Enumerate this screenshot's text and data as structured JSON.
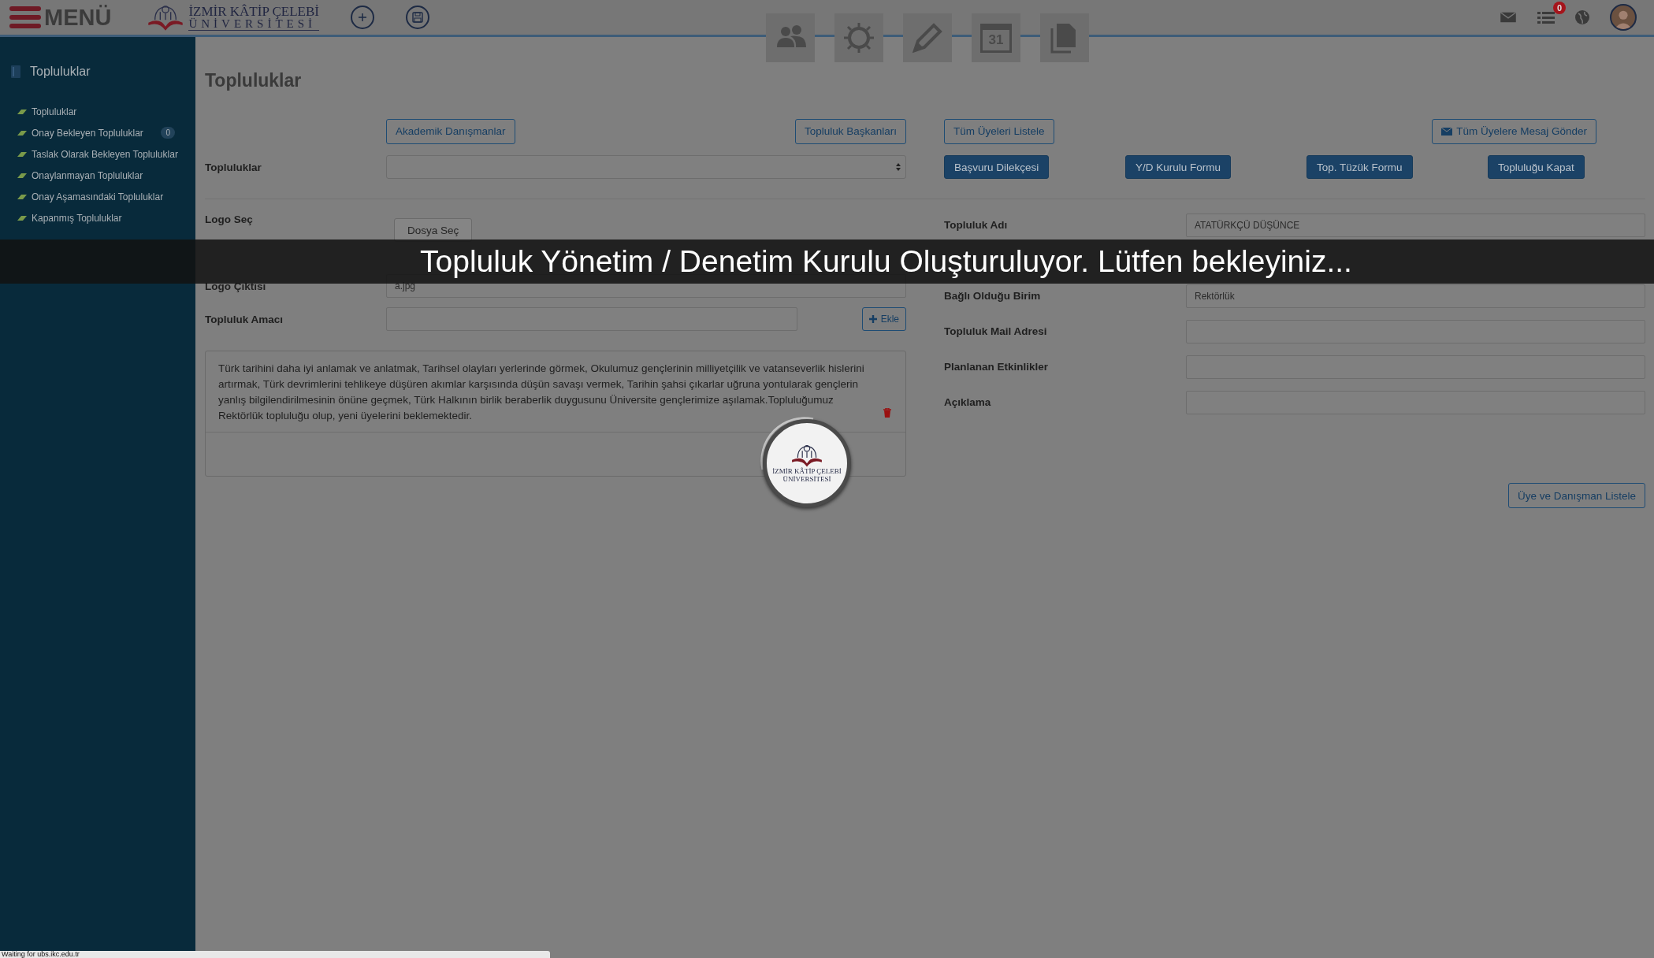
{
  "top_bar": {
    "menu_label": "MENÜ",
    "logo_lines": [
      "İZMİR KÂTİP ÇELEBİ",
      "ÜNİVERSİTESİ"
    ],
    "tiles": [
      {
        "kind": "people"
      },
      {
        "kind": "sun"
      },
      {
        "kind": "pencil"
      },
      {
        "kind": "calendar",
        "text": "31"
      },
      {
        "kind": "documents"
      }
    ],
    "list_badge": "0"
  },
  "sidebar": {
    "title": "Topluluklar",
    "items": [
      {
        "label": "Topluluklar"
      },
      {
        "label": "Onay Bekleyen Topluluklar",
        "badge": "0"
      },
      {
        "label": "Taslak Olarak Bekleyen Topluluklar"
      },
      {
        "label": "Onaylanmayan Topluluklar"
      },
      {
        "label": "Onay Aşamasındaki Topluluklar"
      },
      {
        "label": "Kapanmış Topluluklar"
      }
    ]
  },
  "page_title": "Topluluklar",
  "left_buttons": [
    "Akademik Danışmanlar",
    "Topluluk Başkanları"
  ],
  "select_label": "Topluluklar",
  "right_buttons": [
    {
      "label": "Tüm Üyeleri Listele",
      "kind": "plain"
    },
    {
      "label": "Tüm Üyelere Mesaj Gönder",
      "kind": "mail"
    }
  ],
  "action_buttons": [
    "Başvuru Dilekçesi",
    "Y/D Kurulu Formu",
    "Top. Tüzük Formu",
    "Topluluğu Kapat"
  ],
  "left_form": {
    "logo_label": "Logo Seç",
    "file_button": "Dosya Seç",
    "logo_output_label": "Logo Çıktısı",
    "logo_output_value": "a.jpg",
    "purpose_label": "Topluluk Amacı",
    "add_button": "Ekle",
    "purpose_text": "Türk tarihini daha iyi anlamak ve anlatmak, Tarihsel olayları yerlerinde görmek, Okulumuz gençlerinin milliyetçilik ve vatanseverlik hislerini artırmak, Türk devrimlerini tehlikeye düşüren akımlar karşısında düşün savaşı vermek, Tarihin şahsi çıkarlar uğruna yontularak gençlerin yanlış bilgilendirilmesinin önüne geçmek, Türk Halkının birlik beraberlik duygusunu Üniversite gençlerimize aşılamak.Topluluğumuz Rektörlük topluluğu olup, yeni üyelerini beklemektedir."
  },
  "right_form": {
    "fields": [
      {
        "label": "Topluluk Adı",
        "value": "ATATÜRKÇÜ DÜŞÜNCE",
        "kind": "field"
      },
      {
        "kind": "hidden"
      },
      {
        "label": "Bağlı Olduğu Birim",
        "value": "Rektörlük",
        "kind": "field"
      },
      {
        "label": "Topluluk Mail Adresi",
        "kind": "field"
      },
      {
        "label": "Planlanan Etkinlikler",
        "kind": "field"
      },
      {
        "label": "Açıklama",
        "kind": "field"
      }
    ]
  },
  "list_button": "Üye ve Danışman Listele",
  "loading": {
    "message": "Topluluk Yönetim / Denetim Kurulu Oluşturuluyor. Lütfen bekleyiniz...",
    "logo_lines": [
      "İZMİR KÂTİP ÇELEBİ",
      "ÜNİVERSİTESİ"
    ]
  },
  "status_bar": "Waiting for ubs.ikc.edu.tr"
}
